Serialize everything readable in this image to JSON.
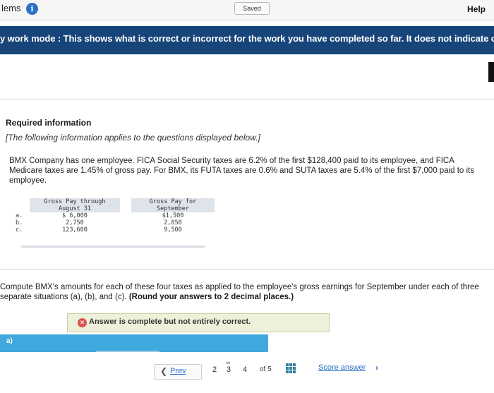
{
  "topbar": {
    "left_text": "lems",
    "info_icon": "info-icon",
    "saved": "Saved",
    "help": "Help"
  },
  "banner": {
    "text": "y work mode : This shows what is correct or incorrect for the work you have completed so far. It does not indicate com"
  },
  "required": {
    "title": "Required information",
    "note": "[The following information applies to the questions displayed below.]",
    "problem": "BMX Company has one employee. FICA Social Security taxes are 6.2% of the first $128,400 paid to its employee, and FICA Medicare taxes are 1.45% of gross pay. For BMX, its FUTA taxes are 0.6% and SUTA taxes are 5.4% of the first $7,000 paid to its employee."
  },
  "table": {
    "headers": [
      "Gross Pay through August 31",
      "Gross Pay for September"
    ],
    "rows": [
      {
        "label": "a.",
        "through_aug": "$ 6,000",
        "sept": "$1,500"
      },
      {
        "label": "b.",
        "through_aug": "2,750",
        "sept": "2,850"
      },
      {
        "label": "c.",
        "through_aug": "123,600",
        "sept": "9,500"
      }
    ]
  },
  "question": {
    "text": "Compute BMX's amounts for each of these four taxes as applied to the employee's gross earnings for September under each of three separate situations (a), (b), and (c).",
    "instruction": "(Round your answers to 2 decimal places.)"
  },
  "status": {
    "text": "Answer is complete but not entirely correct.",
    "icon": "x-circle-icon"
  },
  "part": {
    "label": "a)"
  },
  "pager": {
    "prev": "Prev",
    "pages": [
      "2",
      "3",
      "4"
    ],
    "of": "of 5",
    "score": "Score answer"
  }
}
